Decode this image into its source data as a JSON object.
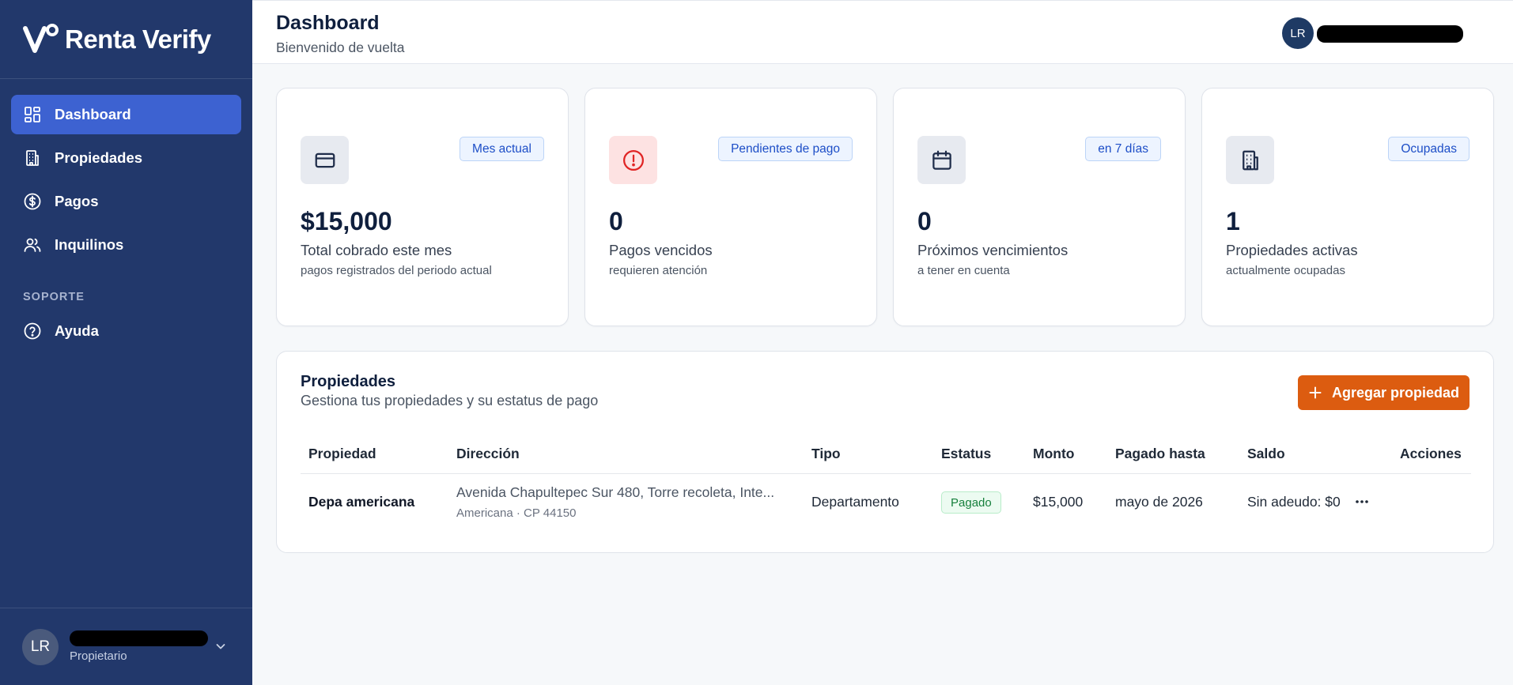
{
  "brand": {
    "name": "Renta Verify"
  },
  "sidebar": {
    "items": [
      {
        "label": "Dashboard",
        "icon": "dashboard-icon",
        "active": true
      },
      {
        "label": "Propiedades",
        "icon": "building-icon"
      },
      {
        "label": "Pagos",
        "icon": "dollar-icon"
      },
      {
        "label": "Inquilinos",
        "icon": "users-icon"
      }
    ],
    "section_label": "SOPORTE",
    "support_items": [
      {
        "label": "Ayuda",
        "icon": "help-icon"
      }
    ],
    "user": {
      "initials": "LR",
      "role": "Propietario"
    }
  },
  "header": {
    "title": "Dashboard",
    "subtitle": "Bienvenido de vuelta",
    "avatar_initials": "LR"
  },
  "cards": [
    {
      "icon": "credit-card-icon",
      "badge": "Mes actual",
      "value": "$15,000",
      "label": "Total cobrado este mes",
      "note": "pagos registrados del periodo actual"
    },
    {
      "icon": "alert-circle-icon",
      "badge": "Pendientes de pago",
      "value": "0",
      "label": "Pagos vencidos",
      "note": "requieren atención"
    },
    {
      "icon": "calendar-icon",
      "badge": "en 7 días",
      "value": "0",
      "label": "Próximos vencimientos",
      "note": "a tener en cuenta"
    },
    {
      "icon": "building-icon",
      "badge": "Ocupadas",
      "value": "1",
      "label": "Propiedades activas",
      "note": "actualmente ocupadas"
    }
  ],
  "properties": {
    "title": "Propiedades",
    "subtitle": "Gestiona tus propiedades y su estatus de pago",
    "add_label": "Agregar propiedad",
    "columns": [
      "Propiedad",
      "Dirección",
      "Tipo",
      "Estatus",
      "Monto",
      "Pagado hasta",
      "Saldo",
      "Acciones"
    ],
    "rows": [
      {
        "name": "Depa americana",
        "address_line1": "Avenida Chapultepec Sur 480, Torre recoleta, Inte...",
        "address_line2": "Americana · CP 44150",
        "type": "Departamento",
        "status": "Pagado",
        "amount": "$15,000",
        "paid_until": "mayo de 2026",
        "balance": "Sin adeudo: $0"
      }
    ]
  },
  "colors": {
    "sidebar_bg": "#22386b",
    "active_nav": "#3d62d1",
    "primary_button": "#dc5c10",
    "status_paid": "#17803d",
    "badge_text": "#1d4ec7"
  }
}
